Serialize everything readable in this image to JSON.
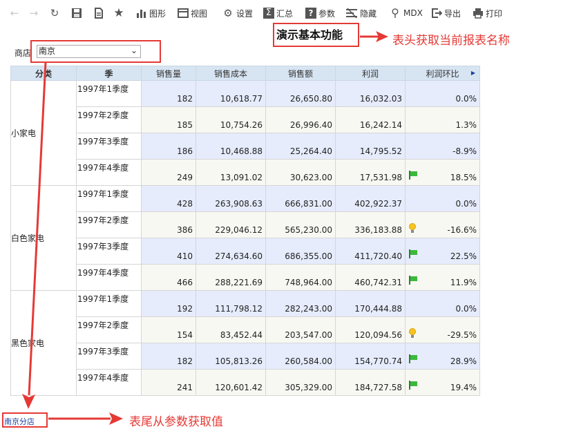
{
  "toolbar": {
    "chart": "图形",
    "view": "视图",
    "settings": "设置",
    "summary": "汇总",
    "params": "参数",
    "hide": "隐藏",
    "mdx": "MDX",
    "export": "导出",
    "print": "打印"
  },
  "report_title": "演示基本功能",
  "filter": {
    "label": "商店",
    "value": "南京"
  },
  "annotations": {
    "header": "表头获取当前报表名称",
    "footer": "表尾从参数获取值"
  },
  "footer": "南京分店",
  "table": {
    "headers": [
      "分类",
      "季",
      "销售量",
      "销售成本",
      "销售额",
      "利润",
      "利润环比"
    ],
    "groups": [
      {
        "category": "小家电",
        "rows": [
          {
            "quarter": "1997年1季度",
            "qty": "182",
            "cost": "10,618.77",
            "sales": "26,650.80",
            "profit": "16,032.03",
            "mom": "0.0%",
            "icon": ""
          },
          {
            "quarter": "1997年2季度",
            "qty": "185",
            "cost": "10,754.26",
            "sales": "26,996.40",
            "profit": "16,242.14",
            "mom": "1.3%",
            "icon": ""
          },
          {
            "quarter": "1997年3季度",
            "qty": "186",
            "cost": "10,468.88",
            "sales": "25,264.40",
            "profit": "14,795.52",
            "mom": "-8.9%",
            "icon": ""
          },
          {
            "quarter": "1997年4季度",
            "qty": "249",
            "cost": "13,091.02",
            "sales": "30,623.00",
            "profit": "17,531.98",
            "mom": "18.5%",
            "icon": "green-flag"
          }
        ]
      },
      {
        "category": "白色家电",
        "rows": [
          {
            "quarter": "1997年1季度",
            "qty": "428",
            "cost": "263,908.63",
            "sales": "666,831.00",
            "profit": "402,922.37",
            "mom": "0.0%",
            "icon": ""
          },
          {
            "quarter": "1997年2季度",
            "qty": "386",
            "cost": "229,046.12",
            "sales": "565,230.00",
            "profit": "336,183.88",
            "mom": "-16.6%",
            "icon": "lightbulb"
          },
          {
            "quarter": "1997年3季度",
            "qty": "410",
            "cost": "274,634.60",
            "sales": "686,355.00",
            "profit": "411,720.40",
            "mom": "22.5%",
            "icon": "green-flag"
          },
          {
            "quarter": "1997年4季度",
            "qty": "466",
            "cost": "288,221.69",
            "sales": "748,964.00",
            "profit": "460,742.31",
            "mom": "11.9%",
            "icon": "green-flag"
          }
        ]
      },
      {
        "category": "黑色家电",
        "rows": [
          {
            "quarter": "1997年1季度",
            "qty": "192",
            "cost": "111,798.12",
            "sales": "282,243.00",
            "profit": "170,444.88",
            "mom": "0.0%",
            "icon": ""
          },
          {
            "quarter": "1997年2季度",
            "qty": "154",
            "cost": "83,452.44",
            "sales": "203,547.00",
            "profit": "120,094.56",
            "mom": "-29.5%",
            "icon": "lightbulb"
          },
          {
            "quarter": "1997年3季度",
            "qty": "182",
            "cost": "105,813.26",
            "sales": "260,584.00",
            "profit": "154,770.74",
            "mom": "28.9%",
            "icon": "green-flag"
          },
          {
            "quarter": "1997年4季度",
            "qty": "241",
            "cost": "120,601.42",
            "sales": "305,329.00",
            "profit": "184,727.58",
            "mom": "19.4%",
            "icon": "green-flag"
          }
        ]
      }
    ]
  },
  "colors": {
    "annotation": "#e53935",
    "header_bg": "#d7e4f2",
    "row_blue": "#e6ecfc",
    "row_cream": "#f8f8f3",
    "link": "#1a3fa0"
  }
}
